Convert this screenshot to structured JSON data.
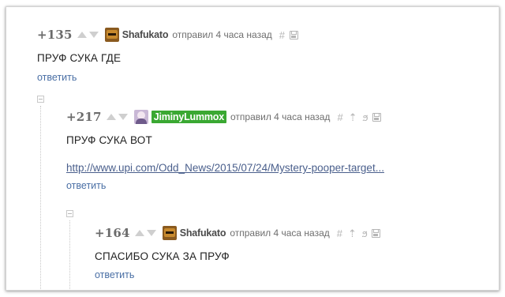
{
  "comments": [
    {
      "rating": "+135",
      "username": "Shafukato",
      "meta": "отправил 4 часа назад",
      "text": "ПРУФ СУКА ГДЕ",
      "reply": "ответить"
    },
    {
      "rating": "+217",
      "username": "JiminyLummox",
      "meta": "отправил 4 часа назад",
      "text": "ПРУФ СУКА ВОТ",
      "link": "http://www.upi.com/Odd_News/2015/07/24/Mystery-pooper-target...",
      "reply": "ответить"
    },
    {
      "rating": "+164",
      "username": "Shafukato",
      "meta": "отправил 4 часа назад",
      "text": "СПАСИБО СУКА ЗА ПРУФ",
      "reply": "ответить"
    }
  ],
  "icons": {
    "hash": "#",
    "parent": "⇡",
    "branch": "ϧ"
  },
  "colors": {
    "highlight_username_bg": "#3aa832",
    "reply_link": "#4a6fa5",
    "url_link": "#4a5f8c"
  }
}
